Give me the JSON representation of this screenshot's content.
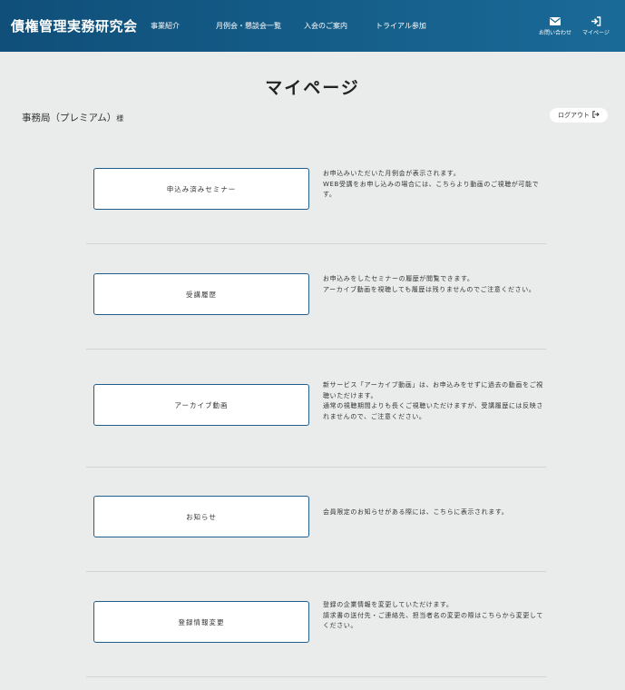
{
  "header": {
    "brand": "債権管理実務研究会",
    "nav": [
      {
        "label": "事業紹介"
      },
      {
        "label": "月例会・懇談会一覧"
      },
      {
        "label": "入会のご案内"
      },
      {
        "label": "トライアル参加"
      }
    ],
    "contact_label": "お問い合わせ",
    "mypage_label": "マイページ"
  },
  "page": {
    "title": "マイページ",
    "user_name": "事務局（プレミアム）",
    "user_suffix": "様",
    "logout_label": "ログアウト"
  },
  "menu": [
    {
      "button": "申込み済みセミナー",
      "description": "お申込みいただいた月例会が表示されます。\nWEB受講をお申し込みの場合には、こちらより動画のご視聴が可能です。"
    },
    {
      "button": "受講履歴",
      "description": "お申込みをしたセミナーの履歴が閲覧できます。\nアーカイブ動画を視聴しても履歴は残りませんのでご注意ください。"
    },
    {
      "button": "アーカイブ動画",
      "description": "新サービス「アーカイブ動画」は、お申込みをせずに過去の動画をご視聴いただけます。\n通常の視聴期間よりも長くご視聴いただけますが、受講履歴には反映されませんので、ご注意ください。"
    },
    {
      "button": "お知らせ",
      "description": "会員限定のお知らせがある際には、こちらに表示されます。"
    },
    {
      "button": "登録情報変更",
      "description": "登録の企業情報を変更していただけます。\n請求書の送付先・ご連絡先、担当者名の変更の際はこちらから変更してください。"
    }
  ],
  "colors": {
    "header_start": "#0f4f79",
    "header_end": "#1a6a98",
    "background": "#e9ecea",
    "button_border": "#1f5f8f"
  }
}
